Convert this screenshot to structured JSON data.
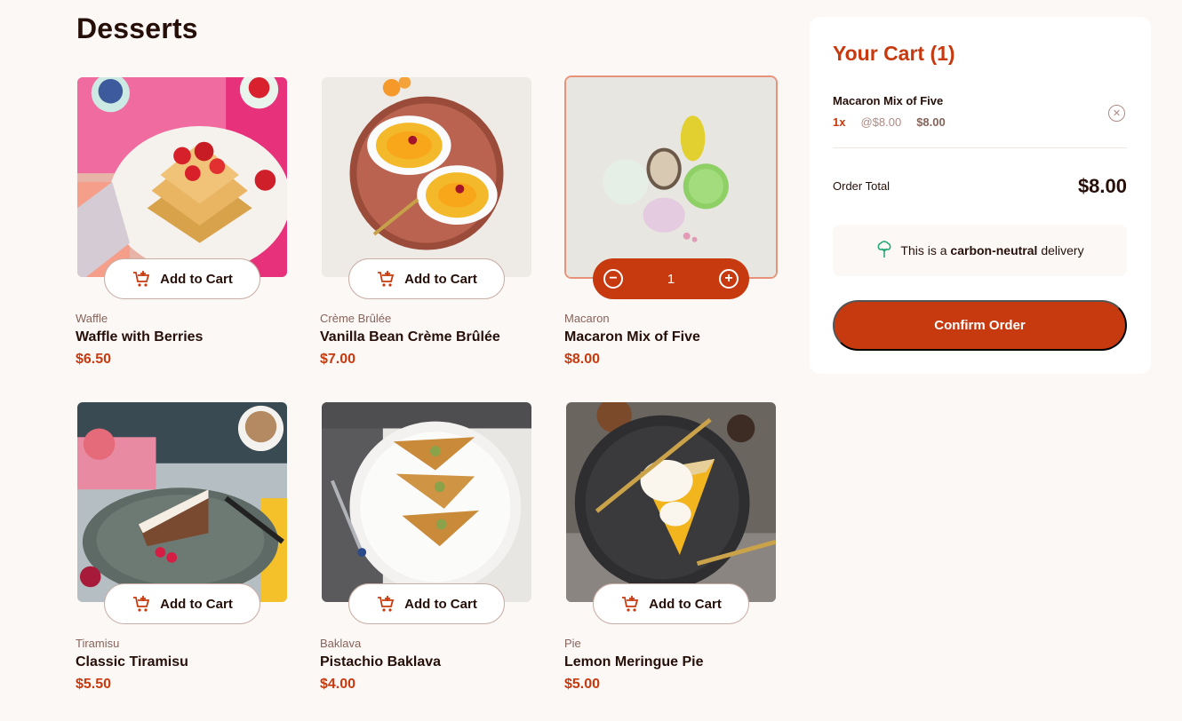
{
  "page": {
    "title": "Desserts"
  },
  "products": [
    {
      "category": "Waffle",
      "name": "Waffle with Berries",
      "price": "$6.50",
      "button": "Add to Cart",
      "image": "waffle-photo"
    },
    {
      "category": "Crème Brûlée",
      "name": "Vanilla Bean Crème Brûlée",
      "price": "$7.00",
      "button": "Add to Cart",
      "image": "creme-brulee-photo"
    },
    {
      "category": "Macaron",
      "name": "Macaron Mix of Five",
      "price": "$8.00",
      "quantity": "1",
      "image": "macaron-photo"
    },
    {
      "category": "Tiramisu",
      "name": "Classic Tiramisu",
      "price": "$5.50",
      "button": "Add to Cart",
      "image": "tiramisu-photo"
    },
    {
      "category": "Baklava",
      "name": "Pistachio Baklava",
      "price": "$4.00",
      "button": "Add to Cart",
      "image": "baklava-photo"
    },
    {
      "category": "Pie",
      "name": "Lemon Meringue Pie",
      "price": "$5.00",
      "button": "Add to Cart",
      "image": "pie-photo"
    }
  ],
  "cart": {
    "title": "Your Cart (1)",
    "items": [
      {
        "name": "Macaron Mix of Five",
        "qty": "1x",
        "unit": "@$8.00",
        "subtotal": "$8.00"
      }
    ],
    "total_label": "Order Total",
    "total": "$8.00",
    "carbon_prefix": "This is a",
    "carbon_bold": "carbon-neutral",
    "carbon_suffix": "delivery",
    "confirm_label": "Confirm Order"
  },
  "colors": {
    "accent": "#c73a0f",
    "background": "#fcf8f6",
    "text": "#260f08"
  },
  "icons": {
    "add_to_cart": "cart-plus-icon",
    "decrement": "minus-circle-icon",
    "increment": "plus-circle-icon",
    "remove": "remove-circle-icon",
    "carbon": "tree-icon"
  }
}
